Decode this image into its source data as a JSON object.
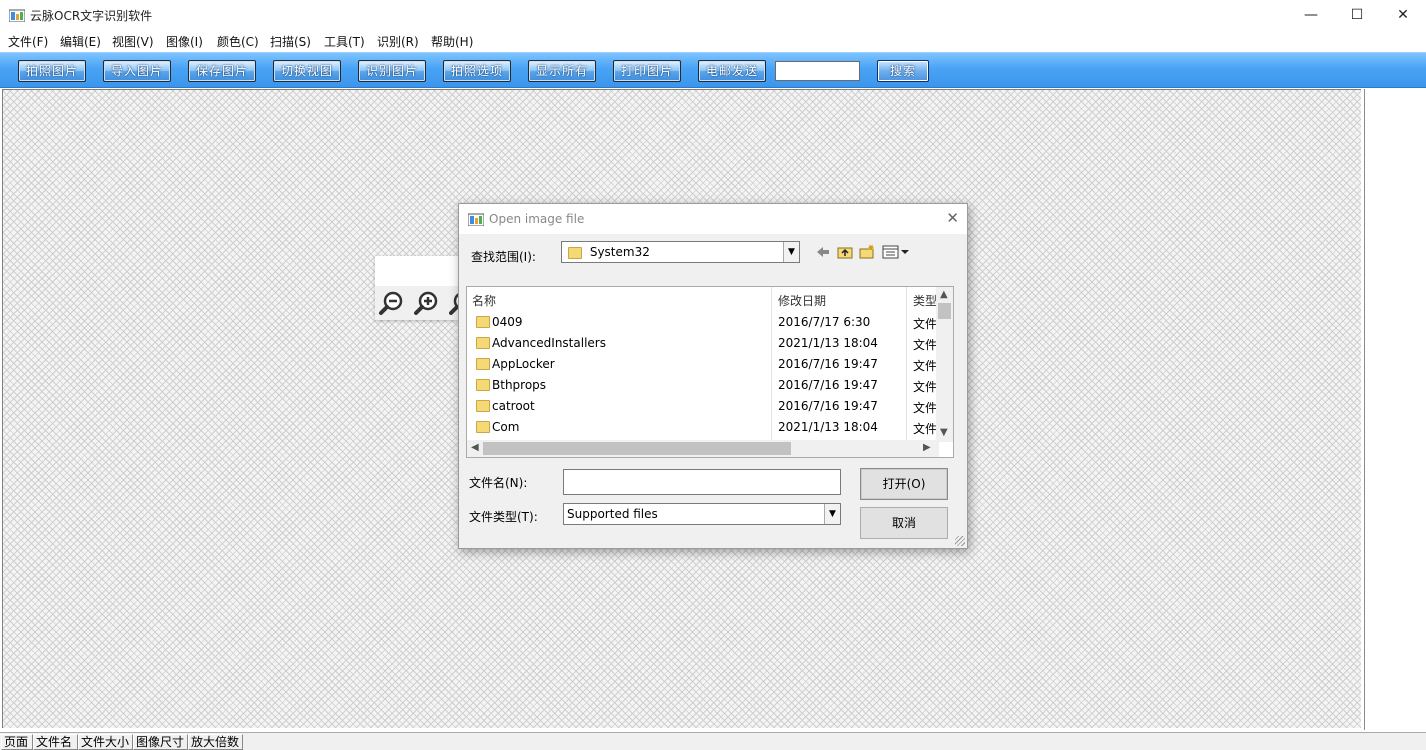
{
  "window": {
    "title": "云脉OCR文字识别软件",
    "minimize_glyph": "—",
    "maximize_glyph": "☐",
    "close_glyph": "✕"
  },
  "menu": {
    "items": [
      "文件(F)",
      "编辑(E)",
      "视图(V)",
      "图像(I)",
      "颜色(C)",
      "扫描(S)",
      "工具(T)",
      "识别(R)",
      "帮助(H)"
    ]
  },
  "toolbar": {
    "buttons": [
      "拍照图片",
      "导入图片",
      "保存图片",
      "切换视图",
      "识别图片",
      "拍照选项",
      "显示所有",
      "打印图片",
      "电邮发送"
    ],
    "search_value": "",
    "search_label": "搜索"
  },
  "zoom_panel": {
    "icons": [
      "zoom-out-icon",
      "zoom-in-icon",
      "zoom-icon"
    ]
  },
  "statusbar": {
    "cells": [
      "页面",
      "文件名",
      "文件大小",
      "图像尺寸",
      "放大倍数"
    ]
  },
  "dialog": {
    "title": "Open image file",
    "close_glyph": "✕",
    "look_in_label": "查找范围(I):",
    "look_in_value": "System32",
    "columns": [
      "名称",
      "修改日期",
      "类型"
    ],
    "files": [
      {
        "name": "0409",
        "date": "2016/7/17 6:30",
        "type": "文件"
      },
      {
        "name": "AdvancedInstallers",
        "date": "2021/1/13 18:04",
        "type": "文件"
      },
      {
        "name": "AppLocker",
        "date": "2016/7/16 19:47",
        "type": "文件"
      },
      {
        "name": "Bthprops",
        "date": "2016/7/16 19:47",
        "type": "文件"
      },
      {
        "name": "catroot",
        "date": "2016/7/16 19:47",
        "type": "文件"
      },
      {
        "name": "Com",
        "date": "2021/1/13 18:04",
        "type": "文件"
      }
    ],
    "filename_label": "文件名(N):",
    "filename_value": "",
    "filetype_label": "文件类型(T):",
    "filetype_value": "Supported files",
    "open_label": "打开(O)",
    "cancel_label": "取消"
  }
}
